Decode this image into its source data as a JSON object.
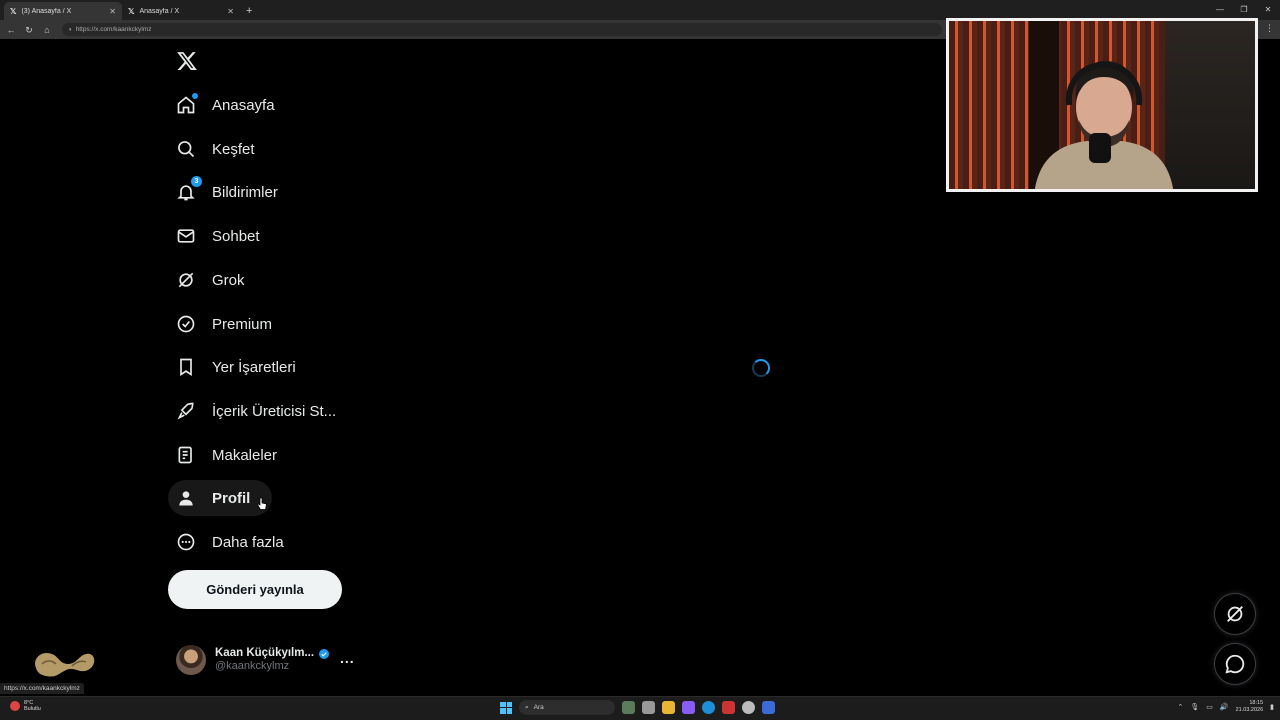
{
  "browser": {
    "tabs": [
      {
        "title": "(3) Anasayfa / X",
        "active": true
      },
      {
        "title": "Anasayfa / X",
        "active": false
      }
    ],
    "new_tab_symbol": "+",
    "url": "https://x.com/kaankckylmz"
  },
  "sidebar": {
    "items": [
      {
        "label": "Anasayfa",
        "icon": "home-icon"
      },
      {
        "label": "Keşfet",
        "icon": "search-icon"
      },
      {
        "label": "Bildirimler",
        "icon": "bell-icon",
        "badge": "3"
      },
      {
        "label": "Sohbet",
        "icon": "mail-icon"
      },
      {
        "label": "Grok",
        "icon": "grok-icon"
      },
      {
        "label": "Premium",
        "icon": "premium-icon"
      },
      {
        "label": "Yer İşaretleri",
        "icon": "bookmark-icon"
      },
      {
        "label": "İçerik Üreticisi St...",
        "icon": "rocket-icon"
      },
      {
        "label": "Makaleler",
        "icon": "article-icon"
      },
      {
        "label": "Profil",
        "icon": "profile-icon"
      },
      {
        "label": "Daha fazla",
        "icon": "more-circle-icon"
      }
    ],
    "post_button": "Gönderi yayınla"
  },
  "account": {
    "name": "Kaan Küçükyılm...",
    "handle": "@kaankckylmz",
    "more": "..."
  },
  "status_url": "https://x.com/kaankckylmz",
  "taskbar": {
    "weather_temp": "8°C",
    "weather_desc": "Bulutlu",
    "search_placeholder": "Ara",
    "time": "18:15",
    "date": "21.03.2026"
  },
  "colors": {
    "background": "#000000",
    "accent": "#1d9bf0",
    "text": "#e7e9ea",
    "muted": "#71767b",
    "post_button_bg": "#eff3f4"
  }
}
